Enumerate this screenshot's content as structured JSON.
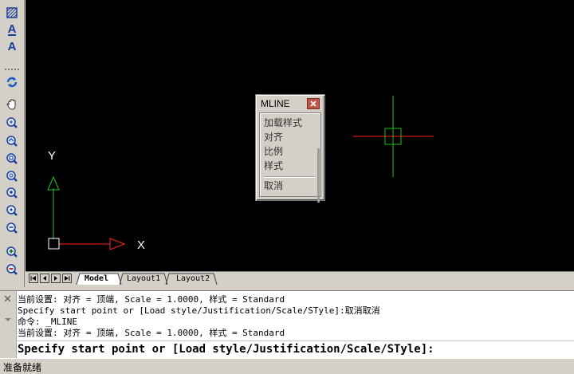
{
  "toolbar": {
    "icons": [
      "hatch-icon",
      "multiline-text-icon",
      "single-text-icon",
      "regen-icon",
      "pan-icon",
      "zoom-realtime-icon",
      "zoom-previous-icon",
      "zoom-window-icon",
      "zoom-dynamic-icon",
      "zoom-scale-icon",
      "zoom-center-icon",
      "zoom-object-icon",
      "zoom-in-icon",
      "zoom-out-icon"
    ],
    "text_label_1": "A",
    "text_label_2": "A"
  },
  "canvas": {
    "background": "#000000",
    "ucs_x_label": "X",
    "ucs_y_label": "Y",
    "x_axis_color": "#ff2020",
    "y_axis_color": "#20c020"
  },
  "context_menu": {
    "title": "MLINE",
    "items": [
      "加载样式",
      "对齐",
      "比例",
      "样式"
    ],
    "cancel": "取消"
  },
  "tabs": {
    "model": "Model",
    "layout1": "Layout1",
    "layout2": "Layout2"
  },
  "command": {
    "history": [
      "当前设置: 对齐 = 顶端, Scale = 1.0000, 样式 = Standard",
      "Specify start point or [Load style/Justification/Scale/STyle]:取消取消",
      "命令: _MLINE",
      "当前设置: 对齐 = 顶端, Scale = 1.0000, 样式 = Standard"
    ],
    "prompt": "Specify start point or [Load style/Justification/Scale/STyle]:"
  },
  "status": {
    "text": "准备就绪"
  }
}
